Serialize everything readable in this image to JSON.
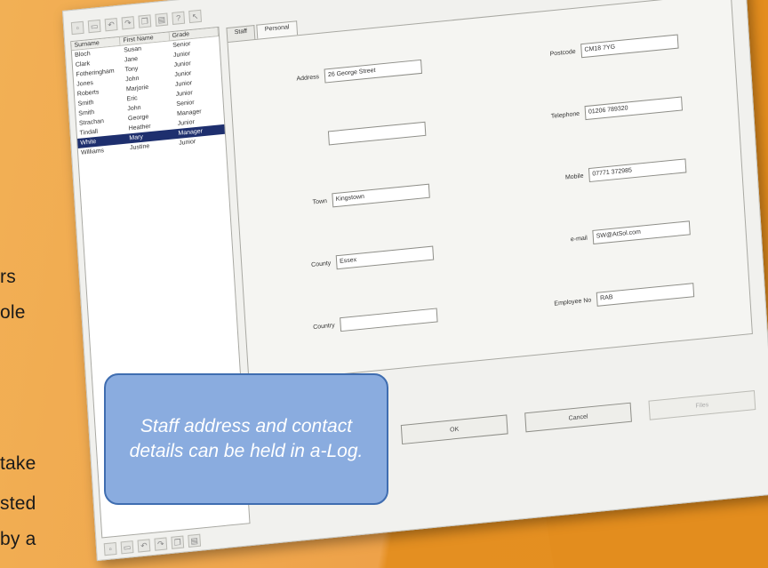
{
  "left_text_fragments": [
    "rs",
    "ole",
    "take",
    "sted",
    "by a"
  ],
  "screenshot": {
    "toolbar_icons": [
      "new-icon",
      "open-icon",
      "undo-icon",
      "redo-icon",
      "copy-icon",
      "print-icon",
      "help-icon",
      "pointer-icon"
    ],
    "list": {
      "columns": [
        "Surname",
        "First Name",
        "Grade"
      ],
      "rows": [
        [
          "Bloch",
          "Susan",
          "Senior"
        ],
        [
          "Clark",
          "Jane",
          "Junior"
        ],
        [
          "Fotheringham",
          "Tony",
          "Junior"
        ],
        [
          "Jones",
          "John",
          "Junior"
        ],
        [
          "Roberts",
          "Marjorie",
          "Junior"
        ],
        [
          "Smith",
          "Eric",
          "Junior"
        ],
        [
          "Smith",
          "John",
          "Senior"
        ],
        [
          "Strachan",
          "George",
          "Manager"
        ],
        [
          "Tindall",
          "Heather",
          "Junior"
        ],
        [
          "White",
          "Mary",
          "Manager"
        ],
        [
          "Williams",
          "Justine",
          "Junior"
        ]
      ],
      "selected_index": 9
    },
    "tabs": [
      "Staff",
      "Personal"
    ],
    "fields_left": [
      {
        "label": "Address",
        "value": "26 George Street"
      },
      {
        "label": "",
        "value": ""
      },
      {
        "label": "Town",
        "value": "Kingstown"
      },
      {
        "label": "County",
        "value": "Essex"
      },
      {
        "label": "Country",
        "value": ""
      }
    ],
    "fields_right": [
      {
        "label": "Postcode",
        "value": "CM18 7YG"
      },
      {
        "label": "Telephone",
        "value": "01206 789320"
      },
      {
        "label": "Mobile",
        "value": "07771 372985"
      },
      {
        "label": "e-mail",
        "value": "SW@AtSol.com"
      },
      {
        "label": "Employee No",
        "value": "RAB"
      }
    ],
    "buttons": {
      "ok": "OK",
      "cancel": "Cancel",
      "files": "Files"
    }
  },
  "callout": {
    "text": "Staff address and contact details can be held in a-Log."
  }
}
